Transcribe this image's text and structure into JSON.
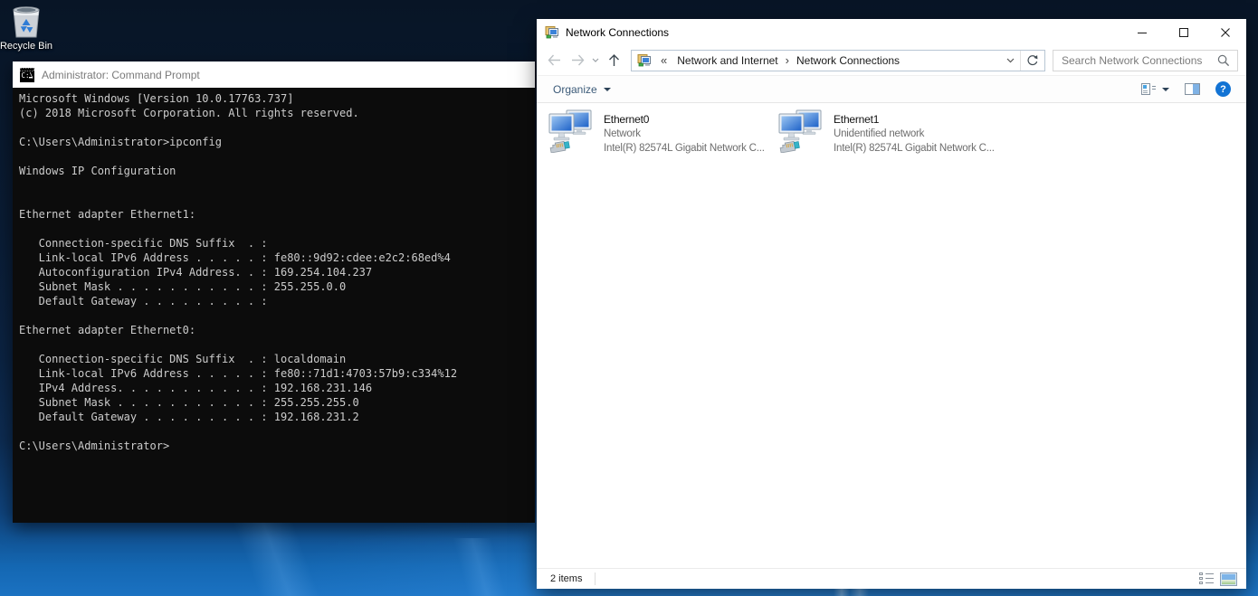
{
  "desktop": {
    "recycle_bin_label": "Recycle Bin"
  },
  "cmd": {
    "title": "Administrator: Command Prompt",
    "console_text": "Microsoft Windows [Version 10.0.17763.737]\n(c) 2018 Microsoft Corporation. All rights reserved.\n\nC:\\Users\\Administrator>ipconfig\n\nWindows IP Configuration\n\n\nEthernet adapter Ethernet1:\n\n   Connection-specific DNS Suffix  . :\n   Link-local IPv6 Address . . . . . : fe80::9d92:cdee:e2c2:68ed%4\n   Autoconfiguration IPv4 Address. . : 169.254.104.237\n   Subnet Mask . . . . . . . . . . . : 255.255.0.0\n   Default Gateway . . . . . . . . . :\n\nEthernet adapter Ethernet0:\n\n   Connection-specific DNS Suffix  . : localdomain\n   Link-local IPv6 Address . . . . . : fe80::71d1:4703:57b9:c334%12\n   IPv4 Address. . . . . . . . . . . : 192.168.231.146\n   Subnet Mask . . . . . . . . . . . : 255.255.255.0\n   Default Gateway . . . . . . . . . : 192.168.231.2\n\nC:\\Users\\Administrator>"
  },
  "win": {
    "title": "Network Connections",
    "nav": {
      "breadcrumb_collapsed": "«",
      "breadcrumb_separator": "›",
      "crumbs": [
        "Network and Internet",
        "Network Connections"
      ]
    },
    "search_placeholder": "Search Network Connections",
    "toolbar": {
      "organize_label": "Organize",
      "help_label": "?"
    },
    "items": [
      {
        "name": "Ethernet0",
        "status": "Network",
        "device": "Intel(R) 82574L Gigabit Network C..."
      },
      {
        "name": "Ethernet1",
        "status": "Unidentified network",
        "device": "Intel(R) 82574L Gigabit Network C..."
      }
    ],
    "status_bar": {
      "items_count": "2 items"
    }
  },
  "colors": {
    "console_bg": "#0c0c0c",
    "console_fg": "#cccccc",
    "help_icon_bg": "#1273d4",
    "organize_text": "#3b5a78",
    "wallpaper_bright": "#1467b2",
    "monitor_screen_blue": "#2a6fd4"
  }
}
